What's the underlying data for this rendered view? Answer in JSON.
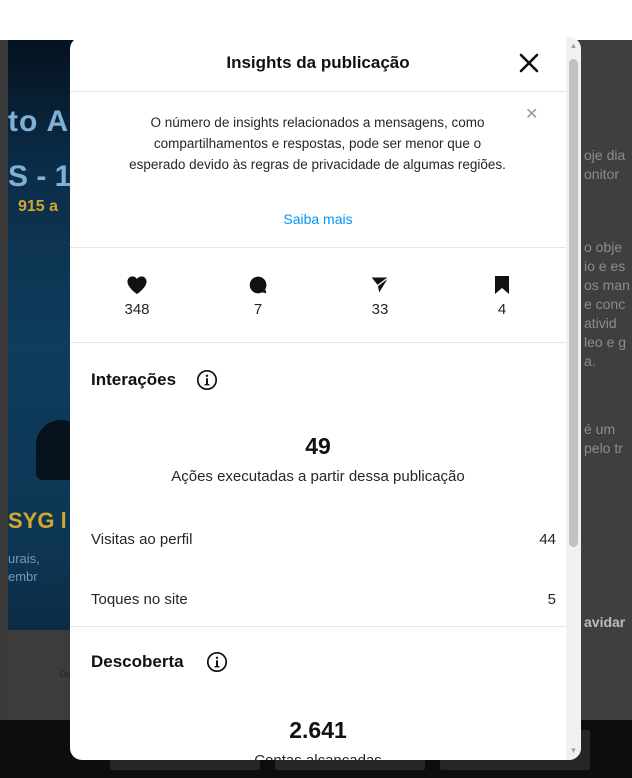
{
  "modal": {
    "title": "Insights da publicação",
    "notice": {
      "text": "O número de insights relacionados a mensagens, como compartilhamentos e respostas, pode ser menor que o esperado devido às regras de privacidade de algumas regiões.",
      "link": "Saiba mais"
    },
    "stats": [
      {
        "icon": "heart-icon",
        "value": "348"
      },
      {
        "icon": "comment-icon",
        "value": "7"
      },
      {
        "icon": "share-icon",
        "value": "33"
      },
      {
        "icon": "bookmark-icon",
        "value": "4"
      }
    ],
    "interacoes": {
      "title": "Interações",
      "total": "49",
      "subtitle": "Ações executadas a partir dessa publicação",
      "rows": [
        {
          "label": "Visitas ao perfil",
          "value": "44"
        },
        {
          "label": "Toques no site",
          "value": "5"
        }
      ]
    },
    "descoberta": {
      "title": "Descoberta",
      "total": "2.641",
      "subtitle": "Contas alcançadas"
    }
  },
  "background": {
    "post_lines": [
      "to A",
      "S - 1",
      "915 a",
      "SYG l",
      "urais,",
      "embr"
    ],
    "post_footer": "Org",
    "right_text": [
      "oje dia",
      "onitor",
      "o obje",
      "io e es",
      "os man",
      "e conc",
      "ativid",
      "leo e g",
      "a.",
      "é um",
      "pelo tr",
      "avidar"
    ]
  },
  "colors": {
    "accent": "#0095f6",
    "overlay": "#3b3b3b"
  }
}
